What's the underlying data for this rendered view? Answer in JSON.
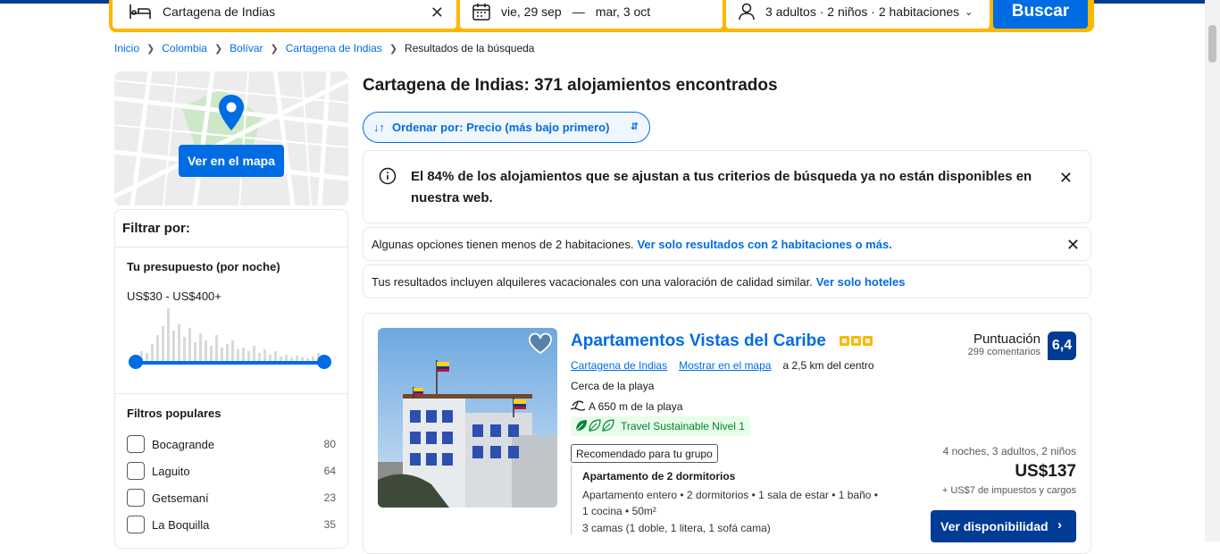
{
  "search": {
    "destination": "Cartagena de Indias",
    "checkin": "vie, 29 sep",
    "dash": "—",
    "checkout": "mar, 3 oct",
    "guests": "3 adultos · 2 niños · 2 habitaciones",
    "button": "Buscar"
  },
  "breadcrumb": [
    "Inicio",
    "Colombia",
    "Bolívar",
    "Cartagena de Indias",
    "Resultados de la búsqueda"
  ],
  "map": {
    "button": "Ver en el mapa"
  },
  "filters": {
    "heading": "Filtrar por:",
    "budget_title": "Tu presupuesto (por noche)",
    "budget_range": "US$30 - US$400+",
    "popular_title": "Filtros populares",
    "items": [
      {
        "name": "Bocagrande",
        "count": "80"
      },
      {
        "name": "Laguito",
        "count": "64"
      },
      {
        "name": "Getsemaní",
        "count": "23"
      },
      {
        "name": "La Boquilla",
        "count": "35"
      }
    ]
  },
  "results": {
    "title": "Cartagena de Indias: 371 alojamientos encontrados",
    "sort": "Ordenar por: Precio (más bajo primero)",
    "notice": "El 84% de los alojamientos que se ajustan a tus criterios de búsqueda ya no están disponibles en nuestra web.",
    "rooms_text": "Algunas opciones tienen menos de 2 habitaciones.",
    "rooms_link": "Ver solo resultados con 2 habitaciones o más.",
    "vacation_text": "Tus resultados incluyen alquileres vacacionales con una valoración de calidad similar.",
    "vacation_link": "Ver solo hoteles"
  },
  "property": {
    "name": "Apartamentos Vistas del Caribe",
    "stars": 3,
    "city": "Cartagena de Indias",
    "map_link": "Mostrar en el mapa",
    "distance": "a 2,5 km del centro",
    "near": "Cerca de la playa",
    "beach": "A 650 m de la playa",
    "sustainable": "Travel Sustainable Nivel 1",
    "recommended": "Recomendado para tu grupo",
    "unit_title": "Apartamento de 2 dormitorios",
    "unit_desc": "Apartamento entero • 2 dormitorios • 1 sala de estar • 1 baño • 1 cocina • 50m²",
    "beds": "3 camas (1 doble, 1 litera, 1 sofá cama)",
    "score_label": "Puntuación",
    "reviews": "299 comentarios",
    "score": "6,4",
    "stay": "4 noches, 3 adultos, 2 niños",
    "price": "US$137",
    "taxes": "+ US$7 de impuestos y cargos",
    "cta": "Ver disponibilidad"
  },
  "colors": {
    "brand": "#003b95",
    "accent": "#006ce4",
    "search_border": "#ffb700",
    "eco": "#008234"
  }
}
